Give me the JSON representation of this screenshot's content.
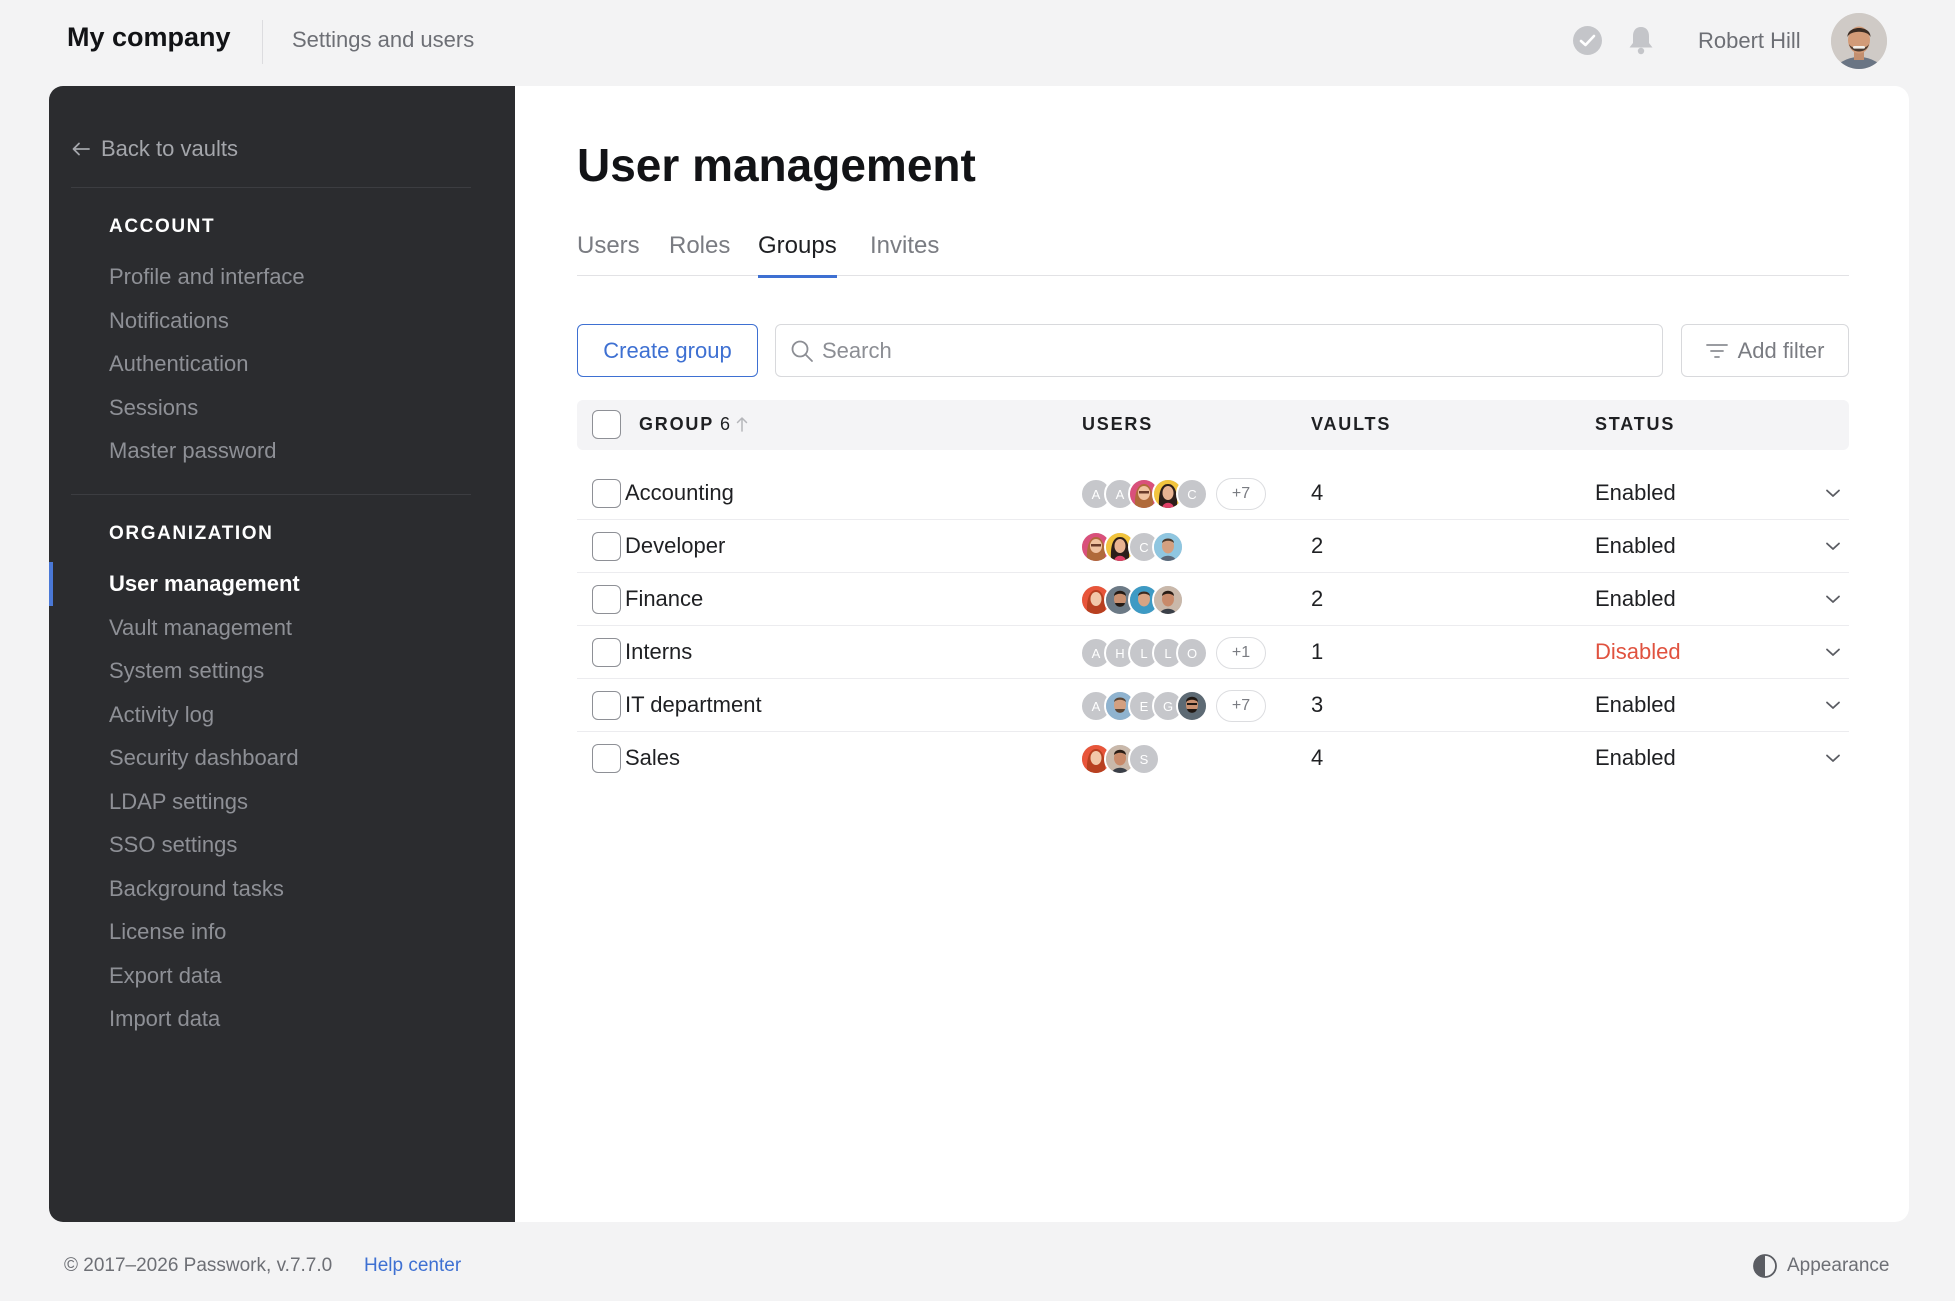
{
  "header": {
    "brand": "My company",
    "section": "Settings and users",
    "user_name": "Robert Hill"
  },
  "sidebar": {
    "back_label": "Back to vaults",
    "account_heading": "ACCOUNT",
    "account_items": [
      "Profile and interface",
      "Notifications",
      "Authentication",
      "Sessions",
      "Master password"
    ],
    "org_heading": "ORGANIZATION",
    "org_items": [
      "User management",
      "Vault management",
      "System settings",
      "Activity log",
      "Security dashboard",
      "LDAP settings",
      "SSO settings",
      "Background tasks",
      "License info",
      "Export data",
      "Import data"
    ]
  },
  "main": {
    "title": "User management",
    "tabs": [
      "Users",
      "Roles",
      "Groups",
      "Invites"
    ],
    "active_tab": "Groups",
    "create_label": "Create group",
    "search_placeholder": "Search",
    "filter_label": "Add filter",
    "columns": {
      "group": "GROUP",
      "group_count": "6",
      "users": "USERS",
      "vaults": "VAULTS",
      "status": "STATUS"
    },
    "rows": [
      {
        "name": "Accounting",
        "vaults": "4",
        "status": "Enabled",
        "more": "+7"
      },
      {
        "name": "Developer",
        "vaults": "2",
        "status": "Enabled",
        "more": ""
      },
      {
        "name": "Finance",
        "vaults": "2",
        "status": "Enabled",
        "more": ""
      },
      {
        "name": "Interns",
        "vaults": "1",
        "status": "Disabled",
        "more": "+1"
      },
      {
        "name": "IT department",
        "vaults": "3",
        "status": "Enabled",
        "more": "+7"
      },
      {
        "name": "Sales",
        "vaults": "4",
        "status": "Enabled",
        "more": ""
      }
    ]
  },
  "footer": {
    "copyright": "© 2017–2026 Passwork, v.7.7.0",
    "help": "Help center",
    "appearance": "Appearance"
  },
  "colors": {
    "accent": "#3e70d2",
    "sidebar": "#2b2c2f",
    "disabled": "#e0523f"
  }
}
